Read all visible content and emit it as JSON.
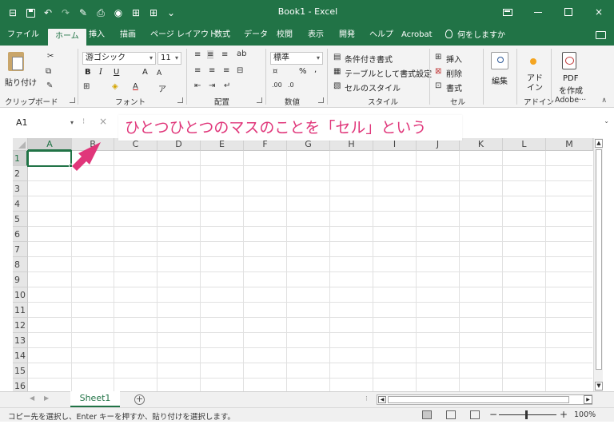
{
  "titlebar": {
    "title": "Book1  -  Excel",
    "ribbon_display_icon": "ribbon-display-options-icon",
    "minimize": "minimize-icon",
    "maximize": "maximize-icon",
    "close": "×"
  },
  "tabs": [
    {
      "label": "ファイル"
    },
    {
      "label": "ホーム"
    },
    {
      "label": "挿入"
    },
    {
      "label": "描画"
    },
    {
      "label": "ページ レイアウト"
    },
    {
      "label": "数式"
    },
    {
      "label": "データ"
    },
    {
      "label": "校閲"
    },
    {
      "label": "表示"
    },
    {
      "label": "開発"
    },
    {
      "label": "ヘルプ"
    },
    {
      "label": "Acrobat"
    }
  ],
  "tell_me": "何をしますか",
  "ribbon": {
    "clipboard": {
      "label": "クリップボード",
      "paste": "貼り付け"
    },
    "font": {
      "label": "フォント",
      "name": "游ゴシック",
      "size": "11",
      "bold": "B",
      "italic": "I",
      "underline": "U",
      "grow": "A",
      "shrink": "A"
    },
    "alignment": {
      "label": "配置"
    },
    "number": {
      "label": "数値",
      "format": "標準",
      "percent": "%",
      "comma": ","
    },
    "styles": {
      "label": "スタイル",
      "conditional": "条件付き書式",
      "as_table": "テーブルとして書式設定",
      "cell_styles": "セルのスタイル"
    },
    "cells": {
      "label": "セル",
      "insert": "挿入",
      "delete": "削除",
      "format": "書式"
    },
    "editing": {
      "label": "編集"
    },
    "addins": {
      "label": "アドイン",
      "button": "アド\nイン"
    },
    "adobe": {
      "label": "Adobe···",
      "button_line1": "PDF",
      "button_line2": "を作成"
    }
  },
  "formula_bar": {
    "name_box": "A1",
    "value": ""
  },
  "annotation": {
    "text": "ひとつひとつのマスのことを「セル」という",
    "color": "#e0367a"
  },
  "grid": {
    "columns": [
      "A",
      "B",
      "C",
      "D",
      "E",
      "F",
      "G",
      "H",
      "I",
      "J",
      "K",
      "L",
      "M"
    ],
    "rows": [
      "1",
      "2",
      "3",
      "4",
      "5",
      "6",
      "7",
      "8",
      "9",
      "10",
      "11",
      "12",
      "13",
      "14",
      "15",
      "16"
    ],
    "selected_cell": "A1"
  },
  "sheets": [
    {
      "name": "Sheet1",
      "active": true
    }
  ],
  "status": {
    "message": "コピー先を選択し、Enter キーを押すか、貼り付けを選択します。",
    "zoom": "100%"
  },
  "colors": {
    "brand": "#217346",
    "annotation": "#e0367a"
  }
}
